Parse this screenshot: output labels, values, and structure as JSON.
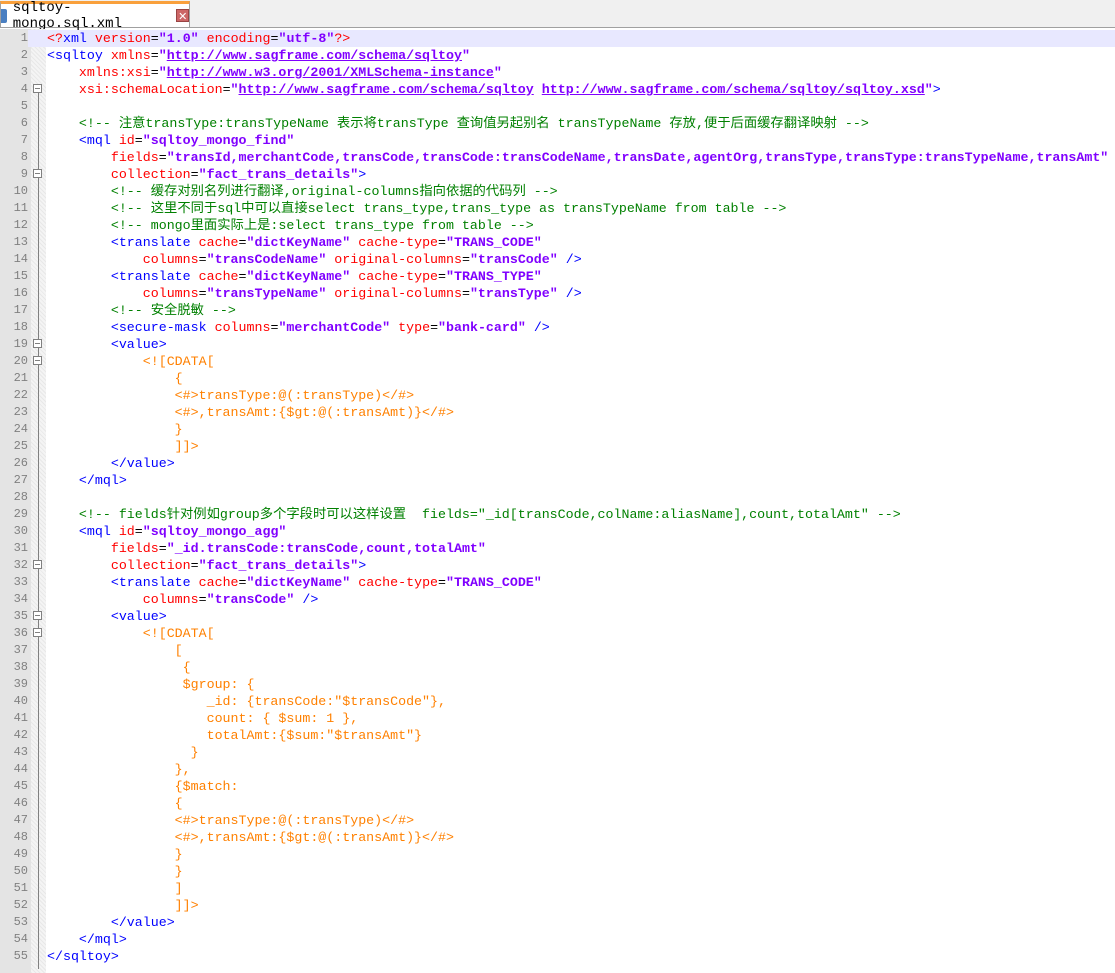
{
  "tab": {
    "label": "sqltoy-mongo.sql.xml",
    "close_icon": "close-icon"
  },
  "colors": {
    "tag": "#0000FF",
    "attr": "#FF0000",
    "value": "#8000FF",
    "comment": "#008000",
    "cdata": "#FF8000",
    "line_number": "#808080"
  },
  "current_line": 1,
  "lines": [
    {
      "n": "1",
      "t": [
        [
          "pi",
          "<?"
        ],
        [
          "tag",
          "xml"
        ],
        [
          "ws",
          " "
        ],
        [
          "attr",
          "version"
        ],
        [
          "eq",
          "="
        ],
        [
          "val",
          "\"1.0\""
        ],
        [
          "ws",
          " "
        ],
        [
          "attr",
          "encoding"
        ],
        [
          "eq",
          "="
        ],
        [
          "val",
          "\"utf-8\""
        ],
        [
          "pi",
          "?>"
        ]
      ]
    },
    {
      "n": "2",
      "t": [
        [
          "tag",
          "<sqltoy"
        ],
        [
          "ws",
          " "
        ],
        [
          "attr",
          "xmlns"
        ],
        [
          "eq",
          "="
        ],
        [
          "val",
          "\""
        ],
        [
          "url",
          "http://www.sagframe.com/schema/sqltoy"
        ],
        [
          "val",
          "\""
        ]
      ]
    },
    {
      "n": "3",
      "t": [
        [
          "ws",
          "    "
        ],
        [
          "attr",
          "xmlns:xsi"
        ],
        [
          "eq",
          "="
        ],
        [
          "val",
          "\""
        ],
        [
          "url",
          "http://www.w3.org/2001/XMLSchema-instance"
        ],
        [
          "val",
          "\""
        ]
      ]
    },
    {
      "n": "4",
      "t": [
        [
          "ws",
          "    "
        ],
        [
          "attr",
          "xsi:schemaLocation"
        ],
        [
          "eq",
          "="
        ],
        [
          "val",
          "\""
        ],
        [
          "url",
          "http://www.sagframe.com/schema/sqltoy"
        ],
        [
          "val",
          " "
        ],
        [
          "url",
          "http://www.sagframe.com/schema/sqltoy/sqltoy.xsd"
        ],
        [
          "val",
          "\""
        ],
        [
          "tag",
          ">"
        ]
      ]
    },
    {
      "n": "5",
      "t": []
    },
    {
      "n": "6",
      "t": [
        [
          "ws",
          "    "
        ],
        [
          "cmt",
          "<!-- 注意transType:transTypeName 表示将transType 查询值另起别名 transTypeName 存放,便于后面缓存翻译映射 -->"
        ]
      ]
    },
    {
      "n": "7",
      "t": [
        [
          "ws",
          "    "
        ],
        [
          "tag",
          "<mql"
        ],
        [
          "ws",
          " "
        ],
        [
          "attr",
          "id"
        ],
        [
          "eq",
          "="
        ],
        [
          "val",
          "\"sqltoy_mongo_find\""
        ]
      ]
    },
    {
      "n": "8",
      "t": [
        [
          "ws",
          "        "
        ],
        [
          "attr",
          "fields"
        ],
        [
          "eq",
          "="
        ],
        [
          "val",
          "\"transId,merchantCode,transCode,transCode:transCodeName,transDate,agentOrg,transType,transType:transTypeName,transAmt\""
        ]
      ]
    },
    {
      "n": "9",
      "t": [
        [
          "ws",
          "        "
        ],
        [
          "attr",
          "collection"
        ],
        [
          "eq",
          "="
        ],
        [
          "val",
          "\"fact_trans_details\""
        ],
        [
          "tag",
          ">"
        ]
      ]
    },
    {
      "n": "10",
      "t": [
        [
          "ws",
          "        "
        ],
        [
          "cmt",
          "<!-- 缓存对别名列进行翻译,original-columns指向依据的代码列 -->"
        ]
      ]
    },
    {
      "n": "11",
      "t": [
        [
          "ws",
          "        "
        ],
        [
          "cmt",
          "<!-- 这里不同于sql中可以直接select trans_type,trans_type as transTypeName from table -->"
        ]
      ]
    },
    {
      "n": "12",
      "t": [
        [
          "ws",
          "        "
        ],
        [
          "cmt",
          "<!-- mongo里面实际上是:select trans_type from table -->"
        ]
      ]
    },
    {
      "n": "13",
      "t": [
        [
          "ws",
          "        "
        ],
        [
          "tag",
          "<translate"
        ],
        [
          "ws",
          " "
        ],
        [
          "attr",
          "cache"
        ],
        [
          "eq",
          "="
        ],
        [
          "val",
          "\"dictKeyName\""
        ],
        [
          "ws",
          " "
        ],
        [
          "attr",
          "cache-type"
        ],
        [
          "eq",
          "="
        ],
        [
          "val",
          "\"TRANS_CODE\""
        ]
      ]
    },
    {
      "n": "14",
      "t": [
        [
          "ws",
          "            "
        ],
        [
          "attr",
          "columns"
        ],
        [
          "eq",
          "="
        ],
        [
          "val",
          "\"transCodeName\""
        ],
        [
          "ws",
          " "
        ],
        [
          "attr",
          "original-columns"
        ],
        [
          "eq",
          "="
        ],
        [
          "val",
          "\"transCode\""
        ],
        [
          "ws",
          " "
        ],
        [
          "tag",
          "/>"
        ]
      ]
    },
    {
      "n": "15",
      "t": [
        [
          "ws",
          "        "
        ],
        [
          "tag",
          "<translate"
        ],
        [
          "ws",
          " "
        ],
        [
          "attr",
          "cache"
        ],
        [
          "eq",
          "="
        ],
        [
          "val",
          "\"dictKeyName\""
        ],
        [
          "ws",
          " "
        ],
        [
          "attr",
          "cache-type"
        ],
        [
          "eq",
          "="
        ],
        [
          "val",
          "\"TRANS_TYPE\""
        ]
      ]
    },
    {
      "n": "16",
      "t": [
        [
          "ws",
          "            "
        ],
        [
          "attr",
          "columns"
        ],
        [
          "eq",
          "="
        ],
        [
          "val",
          "\"transTypeName\""
        ],
        [
          "ws",
          " "
        ],
        [
          "attr",
          "original-columns"
        ],
        [
          "eq",
          "="
        ],
        [
          "val",
          "\"transType\""
        ],
        [
          "ws",
          " "
        ],
        [
          "tag",
          "/>"
        ]
      ]
    },
    {
      "n": "17",
      "t": [
        [
          "ws",
          "        "
        ],
        [
          "cmt",
          "<!-- 安全脱敏 -->"
        ]
      ]
    },
    {
      "n": "18",
      "t": [
        [
          "ws",
          "        "
        ],
        [
          "tag",
          "<secure-mask"
        ],
        [
          "ws",
          " "
        ],
        [
          "attr",
          "columns"
        ],
        [
          "eq",
          "="
        ],
        [
          "val",
          "\"merchantCode\""
        ],
        [
          "ws",
          " "
        ],
        [
          "attr",
          "type"
        ],
        [
          "eq",
          "="
        ],
        [
          "val",
          "\"bank-card\""
        ],
        [
          "ws",
          " "
        ],
        [
          "tag",
          "/>"
        ]
      ]
    },
    {
      "n": "19",
      "t": [
        [
          "ws",
          "        "
        ],
        [
          "tag",
          "<value>"
        ]
      ]
    },
    {
      "n": "20",
      "t": [
        [
          "ws",
          "            "
        ],
        [
          "cdata",
          "<![CDATA["
        ]
      ]
    },
    {
      "n": "21",
      "t": [
        [
          "ws",
          "                "
        ],
        [
          "cdata",
          "{"
        ]
      ]
    },
    {
      "n": "22",
      "t": [
        [
          "ws",
          "                "
        ],
        [
          "cdata",
          "<#>transType:@(:transType)</#>"
        ]
      ]
    },
    {
      "n": "23",
      "t": [
        [
          "ws",
          "                "
        ],
        [
          "cdata",
          "<#>,transAmt:{$gt:@(:transAmt)}</#>"
        ]
      ]
    },
    {
      "n": "24",
      "t": [
        [
          "ws",
          "                "
        ],
        [
          "cdata",
          "}"
        ]
      ]
    },
    {
      "n": "25",
      "t": [
        [
          "ws",
          "                "
        ],
        [
          "cdata",
          "]]>"
        ]
      ]
    },
    {
      "n": "26",
      "t": [
        [
          "ws",
          "        "
        ],
        [
          "tag",
          "</value>"
        ]
      ]
    },
    {
      "n": "27",
      "t": [
        [
          "ws",
          "    "
        ],
        [
          "tag",
          "</mql>"
        ]
      ]
    },
    {
      "n": "28",
      "t": []
    },
    {
      "n": "29",
      "t": [
        [
          "ws",
          "    "
        ],
        [
          "cmt",
          "<!-- fields针对例如group多个字段时可以这样设置  fields=\"_id[transCode,colName:aliasName],count,totalAmt\" -->"
        ]
      ]
    },
    {
      "n": "30",
      "t": [
        [
          "ws",
          "    "
        ],
        [
          "tag",
          "<mql"
        ],
        [
          "ws",
          " "
        ],
        [
          "attr",
          "id"
        ],
        [
          "eq",
          "="
        ],
        [
          "val",
          "\"sqltoy_mongo_agg\""
        ]
      ]
    },
    {
      "n": "31",
      "t": [
        [
          "ws",
          "        "
        ],
        [
          "attr",
          "fields"
        ],
        [
          "eq",
          "="
        ],
        [
          "val",
          "\"_id.transCode:transCode,count,totalAmt\""
        ]
      ]
    },
    {
      "n": "32",
      "t": [
        [
          "ws",
          "        "
        ],
        [
          "attr",
          "collection"
        ],
        [
          "eq",
          "="
        ],
        [
          "val",
          "\"fact_trans_details\""
        ],
        [
          "tag",
          ">"
        ]
      ]
    },
    {
      "n": "33",
      "t": [
        [
          "ws",
          "        "
        ],
        [
          "tag",
          "<translate"
        ],
        [
          "ws",
          " "
        ],
        [
          "attr",
          "cache"
        ],
        [
          "eq",
          "="
        ],
        [
          "val",
          "\"dictKeyName\""
        ],
        [
          "ws",
          " "
        ],
        [
          "attr",
          "cache-type"
        ],
        [
          "eq",
          "="
        ],
        [
          "val",
          "\"TRANS_CODE\""
        ]
      ]
    },
    {
      "n": "34",
      "t": [
        [
          "ws",
          "            "
        ],
        [
          "attr",
          "columns"
        ],
        [
          "eq",
          "="
        ],
        [
          "val",
          "\"transCode\""
        ],
        [
          "ws",
          " "
        ],
        [
          "tag",
          "/>"
        ]
      ]
    },
    {
      "n": "35",
      "t": [
        [
          "ws",
          "        "
        ],
        [
          "tag",
          "<value>"
        ]
      ]
    },
    {
      "n": "36",
      "t": [
        [
          "ws",
          "            "
        ],
        [
          "cdata",
          "<![CDATA["
        ]
      ]
    },
    {
      "n": "37",
      "t": [
        [
          "ws",
          "                "
        ],
        [
          "cdata",
          "["
        ]
      ]
    },
    {
      "n": "38",
      "t": [
        [
          "ws",
          "                 "
        ],
        [
          "cdata",
          "{"
        ]
      ]
    },
    {
      "n": "39",
      "t": [
        [
          "ws",
          "                 "
        ],
        [
          "cdata",
          "$group: {"
        ]
      ]
    },
    {
      "n": "40",
      "t": [
        [
          "ws",
          "                    "
        ],
        [
          "cdata",
          "_id: {transCode:\"$transCode\"},"
        ]
      ]
    },
    {
      "n": "41",
      "t": [
        [
          "ws",
          "                    "
        ],
        [
          "cdata",
          "count: { $sum: 1 },"
        ]
      ]
    },
    {
      "n": "42",
      "t": [
        [
          "ws",
          "                    "
        ],
        [
          "cdata",
          "totalAmt:{$sum:\"$transAmt\"}"
        ]
      ]
    },
    {
      "n": "43",
      "t": [
        [
          "ws",
          "                  "
        ],
        [
          "cdata",
          "}"
        ]
      ]
    },
    {
      "n": "44",
      "t": [
        [
          "ws",
          "                "
        ],
        [
          "cdata",
          "},"
        ]
      ]
    },
    {
      "n": "45",
      "t": [
        [
          "ws",
          "                "
        ],
        [
          "cdata",
          "{$match:"
        ]
      ]
    },
    {
      "n": "46",
      "t": [
        [
          "ws",
          "                "
        ],
        [
          "cdata",
          "{"
        ]
      ]
    },
    {
      "n": "47",
      "t": [
        [
          "ws",
          "                "
        ],
        [
          "cdata",
          "<#>transType:@(:transType)</#>"
        ]
      ]
    },
    {
      "n": "48",
      "t": [
        [
          "ws",
          "                "
        ],
        [
          "cdata",
          "<#>,transAmt:{$gt:@(:transAmt)}</#>"
        ]
      ]
    },
    {
      "n": "49",
      "t": [
        [
          "ws",
          "                "
        ],
        [
          "cdata",
          "}"
        ]
      ]
    },
    {
      "n": "50",
      "t": [
        [
          "ws",
          "                "
        ],
        [
          "cdata",
          "}"
        ]
      ]
    },
    {
      "n": "51",
      "t": [
        [
          "ws",
          "                "
        ],
        [
          "cdata",
          "]"
        ]
      ]
    },
    {
      "n": "52",
      "t": [
        [
          "ws",
          "                "
        ],
        [
          "cdata",
          "]]>"
        ]
      ]
    },
    {
      "n": "53",
      "t": [
        [
          "ws",
          "        "
        ],
        [
          "tag",
          "</value>"
        ]
      ]
    },
    {
      "n": "54",
      "t": [
        [
          "ws",
          "    "
        ],
        [
          "tag",
          "</mql>"
        ]
      ]
    },
    {
      "n": "55",
      "t": [
        [
          "tag",
          "</sqltoy>"
        ]
      ]
    }
  ],
  "fold_markers": [
    "4",
    "9",
    "19",
    "20",
    "32",
    "35",
    "36"
  ]
}
